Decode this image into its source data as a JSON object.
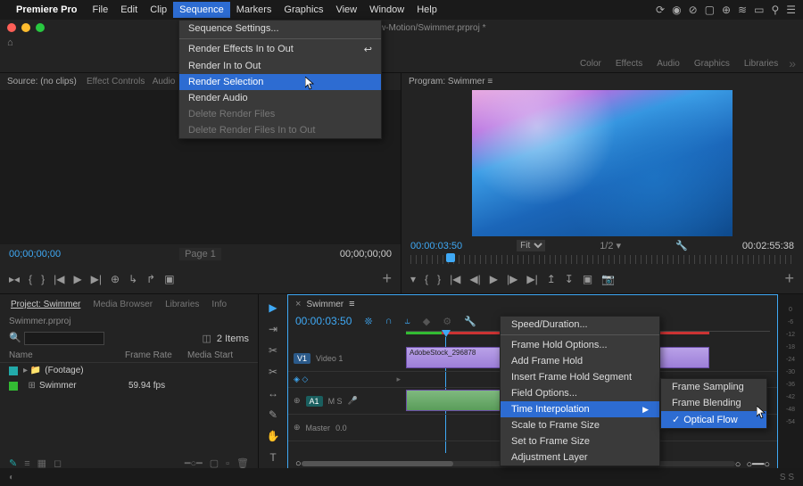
{
  "menubar": {
    "app": "Premiere Pro",
    "items": [
      "File",
      "Edit",
      "Clip",
      "Sequence",
      "Markers",
      "Graphics",
      "View",
      "Window",
      "Help"
    ],
    "active_index": 3
  },
  "titlebar": "we/Desktop/Slow-Motion/Swimmer.prproj *",
  "workspace_tabs": [
    "Color",
    "Effects",
    "Audio",
    "Graphics",
    "Libraries"
  ],
  "source": {
    "title": "Source: (no clips)",
    "tabs": [
      "Effect Controls",
      "Audio"
    ],
    "tc_left": "00;00;00;00",
    "page": "Page 1",
    "tc_right": "00;00;00;00"
  },
  "program": {
    "title": "Program: Swimmer",
    "tc_left": "00:00:03:50",
    "fit": "Fit",
    "scale": "1/2",
    "tc_right": "00:02:55:38"
  },
  "project": {
    "tabs": [
      "Project: Swimmer",
      "Media Browser",
      "Libraries",
      "Info"
    ],
    "file": "Swimmer.prproj",
    "item_count": "2 Items",
    "cols": [
      "Name",
      "Frame Rate",
      "Media Start"
    ],
    "rows": [
      {
        "swatch": "teal",
        "name": "(Footage)",
        "fps": "",
        "folder": true
      },
      {
        "swatch": "grn",
        "name": "Swimmer",
        "fps": "59.94 fps",
        "folder": false
      }
    ]
  },
  "timeline": {
    "name": "Swimmer",
    "tc": "00:00:03:50",
    "tracks": [
      {
        "label": "V1",
        "name": "Video 1",
        "type": "v"
      },
      {
        "label": "A1",
        "name": "",
        "type": "a",
        "meters": "M   S"
      },
      {
        "label": "",
        "name": "Master",
        "type": "m",
        "val": "0.0"
      }
    ],
    "clip_label": "AdobeStock_296878"
  },
  "dropdown": {
    "items": [
      {
        "t": "Sequence Settings...",
        "k": ""
      },
      {
        "sep": true
      },
      {
        "t": "Render Effects In to Out",
        "k": "↩"
      },
      {
        "t": "Render In to Out",
        "k": ""
      },
      {
        "t": "Render Selection",
        "k": "",
        "hl": true
      },
      {
        "t": "Render Audio",
        "k": ""
      },
      {
        "t": "Delete Render Files",
        "k": "",
        "dis": true
      },
      {
        "t": "Delete Render Files In to Out",
        "k": "",
        "dis": true
      }
    ]
  },
  "ctx1": {
    "items": [
      {
        "t": "Speed/Duration..."
      },
      {
        "sep": true
      },
      {
        "t": "Frame Hold Options..."
      },
      {
        "t": "Add Frame Hold"
      },
      {
        "t": "Insert Frame Hold Segment"
      },
      {
        "t": "Field Options..."
      },
      {
        "t": "Time Interpolation",
        "hl": true,
        "sub": true
      },
      {
        "t": "Scale to Frame Size"
      },
      {
        "t": "Set to Frame Size"
      },
      {
        "t": "Adjustment Layer"
      }
    ]
  },
  "ctx2": {
    "items": [
      {
        "t": "Frame Sampling"
      },
      {
        "t": "Frame Blending"
      },
      {
        "t": "Optical Flow",
        "hl": true,
        "chk": true
      }
    ]
  },
  "meters_ticks": [
    "0",
    "-6",
    "-12",
    "-18",
    "-24",
    "-30",
    "-36",
    "-42",
    "-48",
    "-54"
  ],
  "status_short": "S S"
}
